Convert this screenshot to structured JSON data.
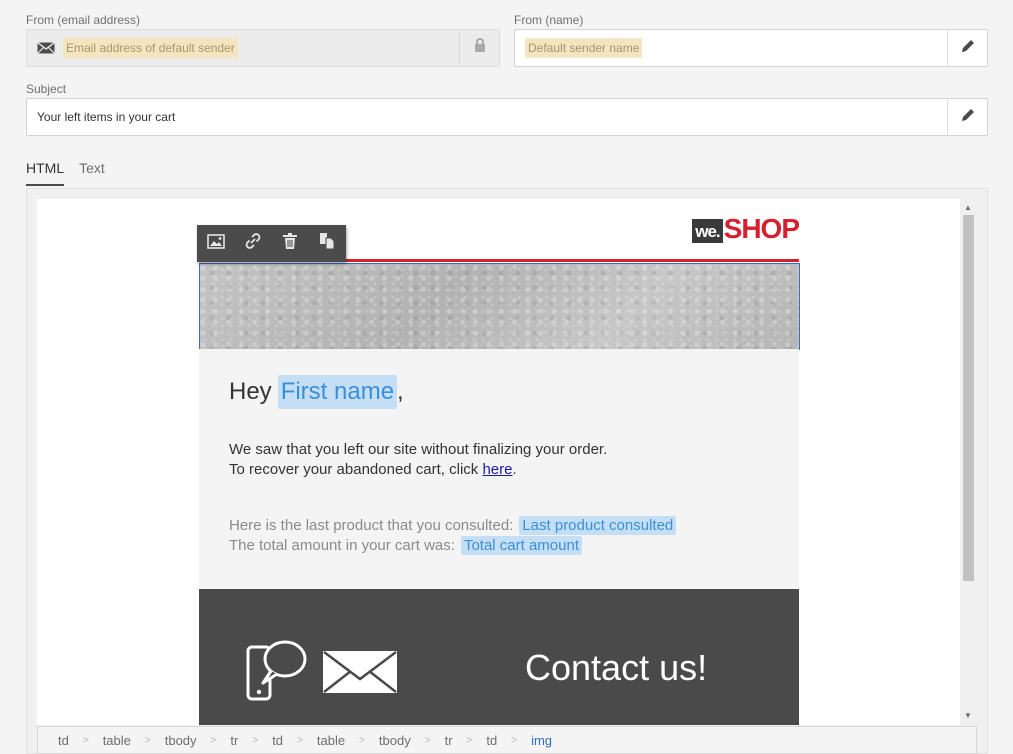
{
  "from_email": {
    "label": "From (email address)",
    "placeholder_token": "Email address of default sender"
  },
  "from_name": {
    "label": "From (name)",
    "placeholder_token": "Default sender name"
  },
  "subject": {
    "label": "Subject",
    "value": "Your left items in your cart"
  },
  "tabs": [
    {
      "label": "HTML",
      "active": true
    },
    {
      "label": "Text",
      "active": false
    }
  ],
  "email": {
    "logo_we": "we.",
    "logo_shop": "SHOP",
    "greeting_prefix": "Hey",
    "greeting_token": "First name",
    "greeting_suffix": ",",
    "line1": "We saw that you left our site without finalizing your order.",
    "line2_prefix": "To recover your abandoned cart, click",
    "line2_link": "here",
    "line2_suffix": ".",
    "last_product_label": "Here is the last product that you consulted:",
    "last_product_token": "Last product consulted",
    "total_label": "The total amount in your cart was:",
    "total_token": "Total cart amount",
    "contact_text": "Contact us!"
  },
  "image_toolbar": [
    "image-icon",
    "link-icon",
    "trash-icon",
    "duplicate-icon"
  ],
  "breadcrumb": [
    "td",
    "table",
    "tbody",
    "tr",
    "td",
    "table",
    "tbody",
    "tr",
    "td",
    "img"
  ],
  "colors": {
    "accent_red": "#d7202e",
    "personalization_bg": "#c4dff5",
    "personalization_text": "#3a8fd6",
    "placeholder_bg": "#f4e5c1",
    "selection_border": "#3c6fb7"
  }
}
